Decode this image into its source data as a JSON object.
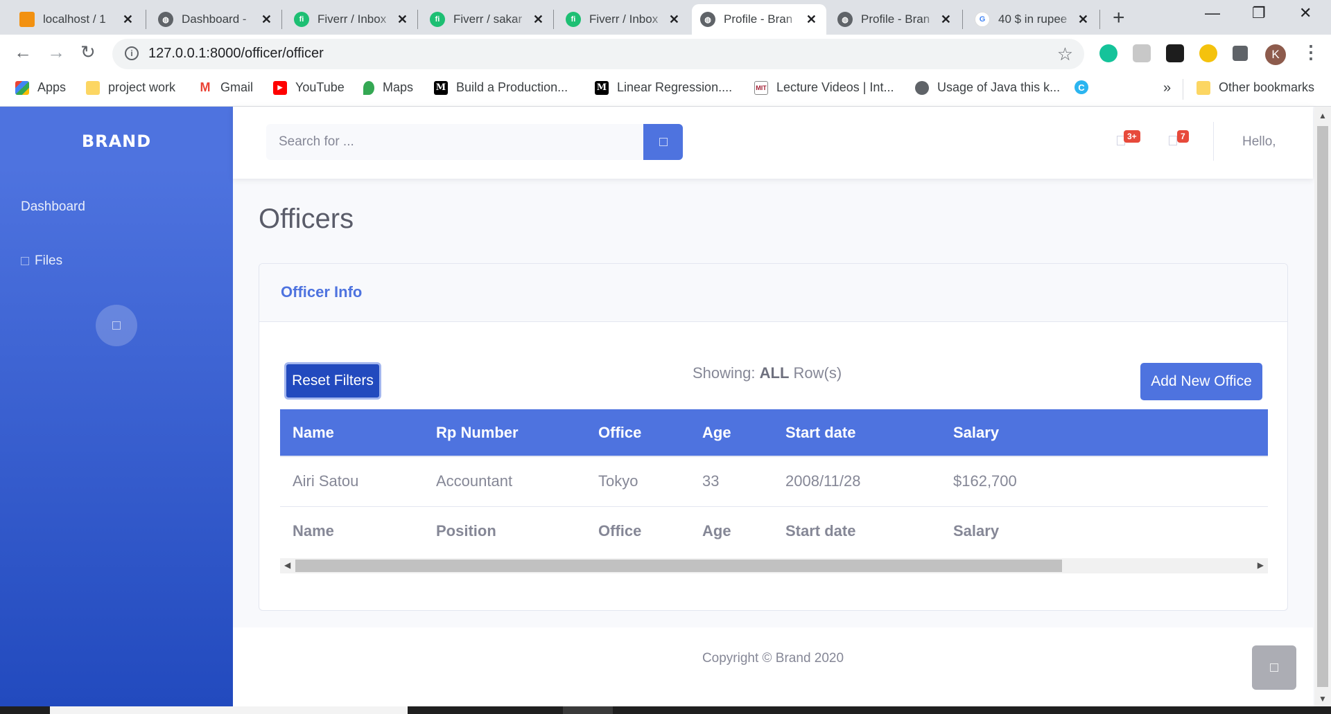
{
  "browser": {
    "tabs": [
      {
        "title": "localhost / 1",
        "favicon_color": "#f29111",
        "active": false
      },
      {
        "title": "Dashboard -",
        "favicon_color": "#5f6368",
        "active": false
      },
      {
        "title": "Fiverr / Inbox",
        "favicon_color": "#1dbf73",
        "active": false
      },
      {
        "title": "Fiverr / sakar",
        "favicon_color": "#1dbf73",
        "active": false
      },
      {
        "title": "Fiverr / Inbox",
        "favicon_color": "#1dbf73",
        "active": false
      },
      {
        "title": "Profile - Bran",
        "favicon_color": "#5f6368",
        "active": true
      },
      {
        "title": "Profile - Bran",
        "favicon_color": "#5f6368",
        "active": false
      },
      {
        "title": "40 $ in rupee",
        "favicon_color": "#4285f4",
        "active": false
      }
    ],
    "url": "127.0.0.1:8000/officer/officer",
    "profile_initial": "K",
    "bookmarks": [
      {
        "label": "Apps",
        "icon": "apps-grid-icon",
        "color": "#4285f4"
      },
      {
        "label": "project work",
        "icon": "folder-icon",
        "color": "#fcd663"
      },
      {
        "label": "Gmail",
        "icon": "gmail-icon",
        "color": "#ea4335"
      },
      {
        "label": "YouTube",
        "icon": "youtube-icon",
        "color": "#ff0000"
      },
      {
        "label": "Maps",
        "icon": "maps-icon",
        "color": "#34a853"
      },
      {
        "label": "Build a Production...",
        "icon": "medium-icon",
        "color": "#000000"
      },
      {
        "label": "Linear Regression....",
        "icon": "medium-icon",
        "color": "#000000"
      },
      {
        "label": "Lecture Videos | Int...",
        "icon": "mit-ocw-icon",
        "color": "#a31f34"
      },
      {
        "label": "Usage of Java this k...",
        "icon": "globe-icon",
        "color": "#5f6368"
      },
      {
        "label": "",
        "icon": "c-logo-icon",
        "color": "#2bb5f0"
      }
    ],
    "overflow_label": "»",
    "other_bookmarks": "Other bookmarks"
  },
  "sidebar": {
    "brand": "BRAND",
    "items": [
      {
        "label": "Dashboard"
      },
      {
        "label": "Files"
      }
    ]
  },
  "topbar": {
    "search_placeholder": "Search for ...",
    "alerts_badge": "3+",
    "messages_badge": "7",
    "greeting": "Hello,"
  },
  "page": {
    "title": "Officers",
    "card_title": "Officer Info",
    "reset_button": "Reset Filters",
    "showing_prefix": "Showing:",
    "showing_value": "ALL",
    "showing_suffix": "Row(s)",
    "add_button": "Add New Office"
  },
  "table": {
    "header": [
      "Name",
      "Rp Number",
      "Office",
      "Age",
      "Start date",
      "Salary"
    ],
    "rows": [
      [
        "Airi Satou",
        "Accountant",
        "Tokyo",
        "33",
        "2008/11/28",
        "$162,700"
      ]
    ],
    "footer": [
      "Name",
      "Position",
      "Office",
      "Age",
      "Start date",
      "Salary"
    ]
  },
  "footer": {
    "copyright": "Copyright © Brand 2020"
  },
  "colors": {
    "primary": "#4e73df",
    "primary_dark": "#224abe",
    "danger": "#e74a3b",
    "text_muted": "#858796"
  }
}
